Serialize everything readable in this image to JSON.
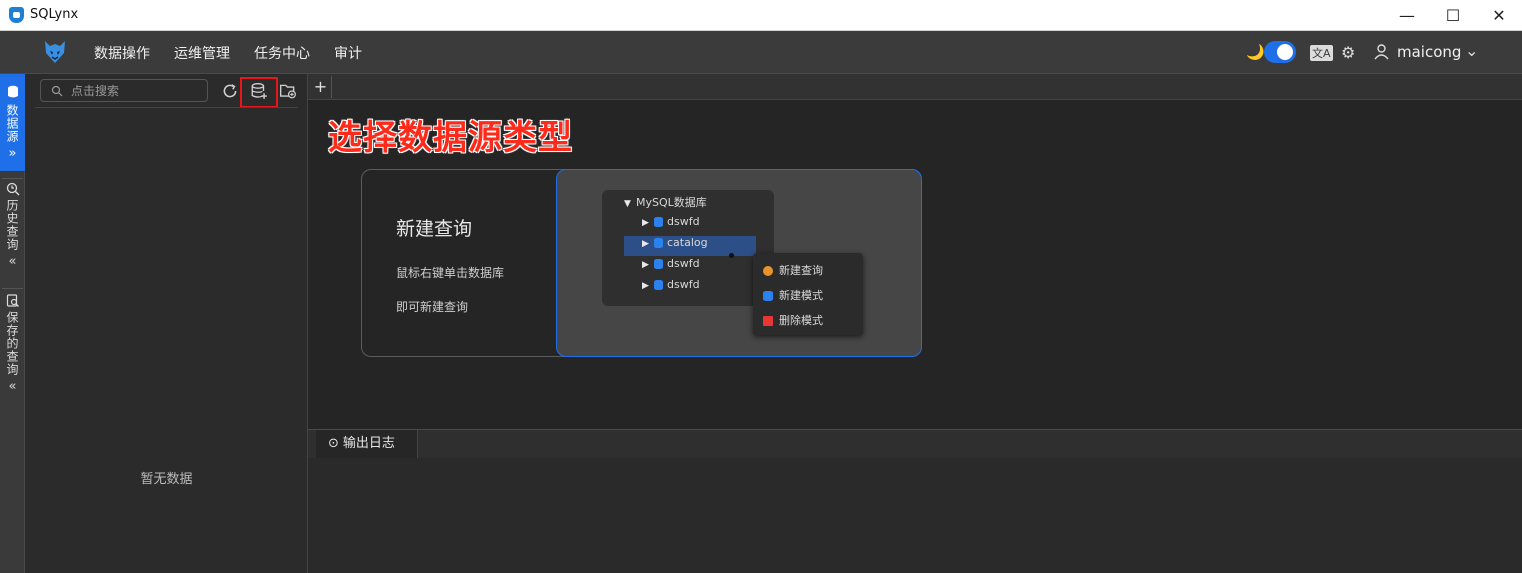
{
  "window": {
    "title": "SQLynx",
    "minimize": "—",
    "maximize": "☐",
    "close": "✕"
  },
  "menubar": {
    "items": [
      "数据操作",
      "运维管理",
      "任务中心",
      "审计"
    ],
    "theme_icon": "🌙",
    "translate_icon": "文A",
    "settings_icon": "⚙",
    "user_icon": "👤",
    "username": "maicong",
    "user_caret": "⌄"
  },
  "activitybar": {
    "tabs": [
      {
        "label": "数据源",
        "icon": "database-icon",
        "arrow": "»"
      },
      {
        "label": "历史查询",
        "icon": "history-icon",
        "arrow": "«"
      },
      {
        "label": "保存的查询",
        "icon": "saved-query-icon",
        "arrow": "«"
      }
    ]
  },
  "sidebar": {
    "search_placeholder": "点击搜索",
    "refresh_icon": "⟳",
    "add_datasource_icon": "⊞",
    "add_folder_icon": "▭",
    "empty_text": "暂无数据"
  },
  "editor": {
    "add_tab_label": "+",
    "annotation": "选择数据源类型",
    "card": {
      "title": "新建查询",
      "line1": "鼠标右键单击数据库",
      "line2": "即可新建查询"
    },
    "preview": {
      "root": "MySQL数据库",
      "nodes": [
        "dswfd",
        "catalog",
        "dswfd",
        "dswfd"
      ],
      "context_menu": [
        {
          "label": "新建查询",
          "color": "#e8942b"
        },
        {
          "label": "新建模式",
          "color": "#2b82ee"
        },
        {
          "label": "删除模式",
          "color": "#e83535"
        }
      ]
    }
  },
  "output": {
    "tab_label": "输出日志",
    "tab_icon": "⊙"
  },
  "colors": {
    "accent": "#1e6fe8",
    "highlight": "#e8151a",
    "annotation": "#ff2a1a"
  }
}
